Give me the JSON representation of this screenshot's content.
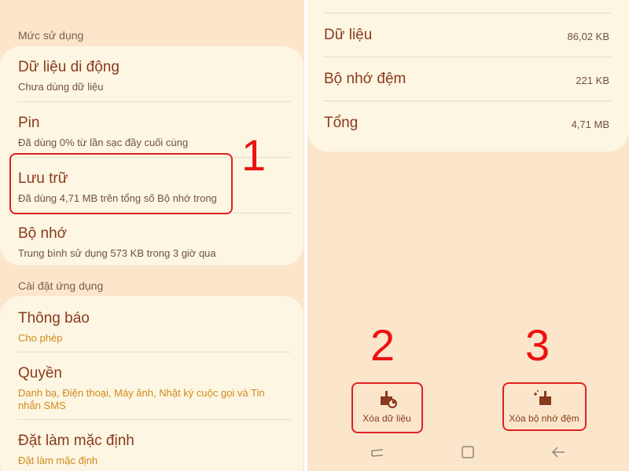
{
  "left": {
    "usage_header": "Mức sử dụng",
    "usage_items": [
      {
        "title": "Dữ liệu di động",
        "sub": "Chưa dùng dữ liệu"
      },
      {
        "title": "Pin",
        "sub": "Đã dùng 0% từ lần sạc đầy cuối cùng"
      },
      {
        "title": "Lưu trữ",
        "sub": "Đã dùng 4,71 MB trên tổng số Bộ nhớ trong"
      },
      {
        "title": "Bộ nhớ",
        "sub": "Trung bình sử dụng 573 KB trong 3 giờ qua"
      }
    ],
    "app_settings_header": "Cài đặt ứng dụng",
    "app_items": [
      {
        "title": "Thông báo",
        "sub": "Cho phép"
      },
      {
        "title": "Quyền",
        "sub": "Danh bạ, Điện thoại, Máy ảnh, Nhật ký cuộc gọi và Tin nhắn SMS"
      },
      {
        "title": "Đặt làm mặc định",
        "sub": "Đặt làm mặc định"
      }
    ]
  },
  "right": {
    "storage_rows": [
      {
        "label": "Dữ liệu",
        "value": "86,02 KB"
      },
      {
        "label": "Bộ nhớ đệm",
        "value": "221 KB"
      },
      {
        "label": "Tổng",
        "value": "4,71 MB"
      }
    ],
    "clear_data_label": "Xóa dữ liệu",
    "clear_cache_label": "Xóa bộ nhớ đệm"
  },
  "annotations": {
    "step1": "1",
    "step2": "2",
    "step3": "3"
  },
  "colors": {
    "background": "#fbe6cc",
    "card": "#fdf6e3",
    "title_text": "#8a3a1c",
    "accent_sub": "#d08a1a",
    "highlight": "#e02020"
  },
  "navbar": {
    "icons": [
      "recent-apps-icon",
      "home-icon",
      "back-icon"
    ]
  }
}
